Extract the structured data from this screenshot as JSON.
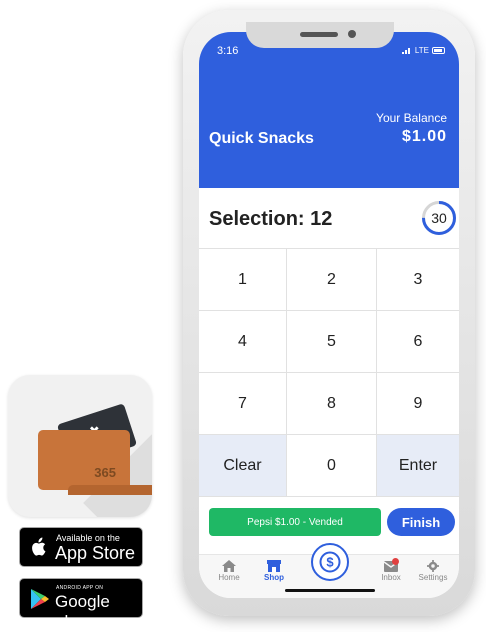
{
  "app_icon": {
    "name": "365-wallet-app-icon",
    "text": "365"
  },
  "badges": {
    "apple_small": "Available on the",
    "apple_big": "App Store",
    "google_small": "ANDROID APP ON",
    "google_big": "Google play"
  },
  "phone": {
    "status_time": "3:16",
    "status_network": "LTE",
    "title": "Quick Snacks",
    "balance_label": "Your Balance",
    "balance_value": "$1.00",
    "selection_text": "Selection: 12",
    "timer_value": "30",
    "keys": [
      "1",
      "2",
      "3",
      "4",
      "5",
      "6",
      "7",
      "8",
      "9",
      "Clear",
      "0",
      "Enter"
    ],
    "vended_text": "Pepsi $1.00 - Vended",
    "finish_label": "Finish",
    "tabs": {
      "home": "Home",
      "shop": "Shop",
      "inbox": "Inbox",
      "settings": "Settings"
    },
    "colors": {
      "primary": "#2f5fdd",
      "success": "#1fb865",
      "wallet": "#c8743a"
    }
  }
}
